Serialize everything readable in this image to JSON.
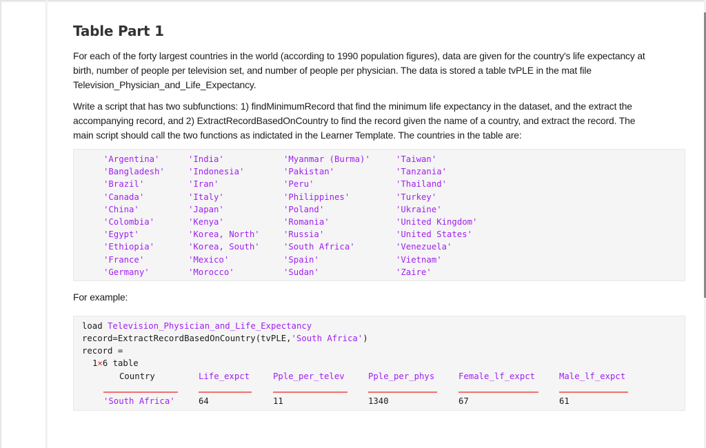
{
  "heading": "Table Part 1",
  "paragraphs": {
    "intro": "For each of the forty largest countries in the world (according to 1990 population figures), data are given for the country's life expectancy at birth, number of people per television set, and number of people per physician.  The data is stored a table tvPLE in the mat  file Television_Physician_and_Life_Expectancy.",
    "task": "Write a script that has two subfunctions: 1) findMinimumRecord that find the minimum life expectancy in the dataset, and the extract the accompanying record, and 2) ExtractRecordBasedOnCountry to find the record given the name of a country, and extract the record.  The main script should call the two functions as indictated in the Learner Template.  The countries in the table are:",
    "for_example": "For example:"
  },
  "intro_lines": [
    "For each of the forty largest countries in the world (according to 1990 population figures), data are given for the country's life expectancy at",
    "birth, number of people per television set, and number of people per physician.  The data is stored a table tvPLE in the mat  file",
    "Television_Physician_and_Life_Expectancy."
  ],
  "task_lines": [
    "Write a script that has two subfunctions: 1) findMinimumRecord that find the minimum life expectancy in the dataset, and the extract the",
    "accompanying record, and 2) ExtractRecordBasedOnCountry to find the record given the name of a country, and extract the record.  The",
    "main script should call the two functions as indictated in the Learner Template.  The countries in the table are:"
  ],
  "countries": [
    [
      "'Argentina'",
      "'Bangladesh'",
      "'Brazil'",
      "'Canada'",
      "'China'",
      "'Colombia'",
      "'Egypt'",
      "'Ethiopia'",
      "'France'",
      "'Germany'"
    ],
    [
      "'India'",
      "'Indonesia'",
      "'Iran'",
      "'Italy'",
      "'Japan'",
      "'Kenya'",
      "'Korea, North'",
      "'Korea, South'",
      "'Mexico'",
      "'Morocco'"
    ],
    [
      "'Myanmar (Burma)'",
      "'Pakistan'",
      "'Peru'",
      "'Philippines'",
      "'Poland'",
      "'Romania'",
      "'Russia'",
      "'South Africa'",
      "'Spain'",
      "'Sudan'"
    ],
    [
      "'Taiwan'",
      "'Tanzania'",
      "'Thailand'",
      "'Turkey'",
      "'Ukraine'",
      "'United Kingdom'",
      "'United States'",
      "'Venezuela'",
      "'Vietnam'",
      "'Zaire'"
    ]
  ],
  "example": {
    "load_cmd": "load ",
    "load_arg": "Television_Physician_and_Life_Expectancy",
    "call_prefix": "record=ExtractRecordBasedOnCountry(tvPLE,",
    "call_arg": "'South Africa'",
    "call_suffix": ")",
    "output_var": "record =",
    "size_rows": "1",
    "size_times": "×",
    "size_cols": "6 table",
    "table": {
      "headers": [
        "Country",
        "Life_expct",
        "Pple_per_telev",
        "Pple_per_phys",
        "Female_lf_expct",
        "Male_lf_expct"
      ],
      "row": [
        "'South Africa'",
        "64",
        "11",
        "1340",
        "67",
        "61"
      ]
    }
  },
  "colors": {
    "string": "#a020f0",
    "rule": "#f07070",
    "times": "#e02020",
    "code_bg": "#f5f5f5"
  }
}
